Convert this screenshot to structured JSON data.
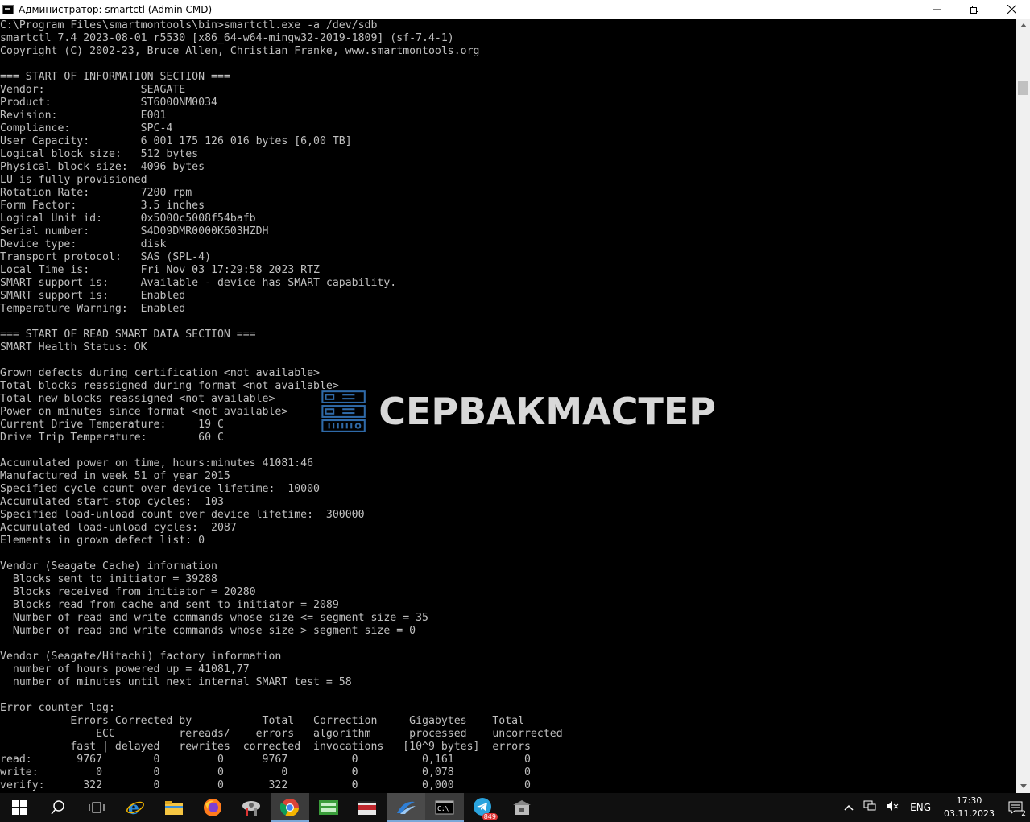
{
  "window": {
    "title": "Администратор: smartctl (Admin CMD)",
    "minimize": "—",
    "maximize": "❐",
    "close": "✕"
  },
  "console": {
    "lines": [
      "C:\\Program Files\\smartmontools\\bin>smartctl.exe -a /dev/sdb",
      "smartctl 7.4 2023-08-01 r5530 [x86_64-w64-mingw32-2019-1809] (sf-7.4-1)",
      "Copyright (C) 2002-23, Bruce Allen, Christian Franke, www.smartmontools.org",
      "",
      "=== START OF INFORMATION SECTION ===",
      "Vendor:               SEAGATE",
      "Product:              ST6000NM0034",
      "Revision:             E001",
      "Compliance:           SPC-4",
      "User Capacity:        6 001 175 126 016 bytes [6,00 TB]",
      "Logical block size:   512 bytes",
      "Physical block size:  4096 bytes",
      "LU is fully provisioned",
      "Rotation Rate:        7200 rpm",
      "Form Factor:          3.5 inches",
      "Logical Unit id:      0x5000c5008f54bafb",
      "Serial number:        S4D09DMR0000K603HZDH",
      "Device type:          disk",
      "Transport protocol:   SAS (SPL-4)",
      "Local Time is:        Fri Nov 03 17:29:58 2023 RTZ",
      "SMART support is:     Available - device has SMART capability.",
      "SMART support is:     Enabled",
      "Temperature Warning:  Enabled",
      "",
      "=== START OF READ SMART DATA SECTION ===",
      "SMART Health Status: OK",
      "",
      "Grown defects during certification <not available>",
      "Total blocks reassigned during format <not available>",
      "Total new blocks reassigned <not available>",
      "Power on minutes since format <not available>",
      "Current Drive Temperature:     19 C",
      "Drive Trip Temperature:        60 C",
      "",
      "Accumulated power on time, hours:minutes 41081:46",
      "Manufactured in week 51 of year 2015",
      "Specified cycle count over device lifetime:  10000",
      "Accumulated start-stop cycles:  103",
      "Specified load-unload count over device lifetime:  300000",
      "Accumulated load-unload cycles:  2087",
      "Elements in grown defect list: 0",
      "",
      "Vendor (Seagate Cache) information",
      "  Blocks sent to initiator = 39288",
      "  Blocks received from initiator = 20280",
      "  Blocks read from cache and sent to initiator = 2089",
      "  Number of read and write commands whose size <= segment size = 35",
      "  Number of read and write commands whose size > segment size = 0",
      "",
      "Vendor (Seagate/Hitachi) factory information",
      "  number of hours powered up = 41081,77",
      "  number of minutes until next internal SMART test = 58",
      "",
      "Error counter log:",
      "           Errors Corrected by           Total   Correction     Gigabytes    Total",
      "               ECC          rereads/    errors   algorithm      processed    uncorrected",
      "           fast | delayed   rewrites  corrected  invocations   [10^9 bytes]  errors",
      "read:       9767        0         0      9767          0          0,161           0",
      "write:         0        0         0         0          0          0,078           0",
      "verify:      322        0         0       322          0          0,000           0"
    ]
  },
  "watermark": {
    "text": "СЕРВАКМАСТЕР"
  },
  "taskbar": {
    "telegram_badge": "849",
    "language": "ENG",
    "time": "17:30",
    "date": "03.11.2023",
    "notifications_count": "2"
  }
}
